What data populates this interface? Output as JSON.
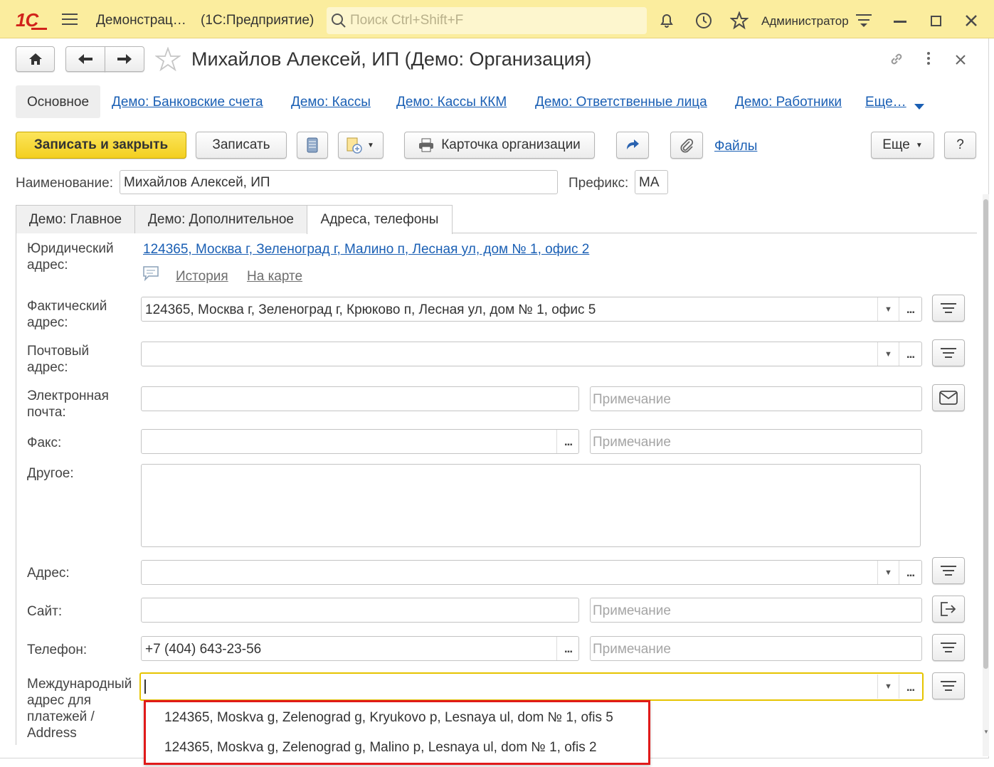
{
  "titlebar": {
    "app_name": "Демонстрац…",
    "platform": "(1С:Предприятие)",
    "search_placeholder": "Поиск Ctrl+Shift+F",
    "user": "Администратор"
  },
  "form": {
    "title": "Михайлов Алексей, ИП (Демо: Организация)",
    "nav_links": [
      "Основное",
      "Демо: Банковские счета",
      "Демо: Кассы",
      "Демо: Кассы ККМ",
      "Демо: Ответственные лица",
      "Демо: Работники",
      "Еще…"
    ],
    "toolbar": {
      "save_close": "Записать и закрыть",
      "save": "Записать",
      "org_card": "Карточка организации",
      "files": "Файлы",
      "more": "Еще",
      "help": "?"
    },
    "name_label": "Наименование:",
    "name_value": "Михайлов Алексей, ИП",
    "prefix_label": "Префикс:",
    "prefix_value": "МА",
    "tabs": [
      "Демо: Главное",
      "Демо: Дополнительное",
      "Адреса, телефоны"
    ],
    "active_tab": "Адреса, телефоны"
  },
  "contacts": {
    "legal_label_1": "Юридический",
    "legal_label_2": "адрес:",
    "legal_value": "124365, Москва г, Зеленоград г, Малино п, Лесная ул, дом № 1, офис 2",
    "history": "История",
    "on_map": "На карте",
    "actual_label_1": "Фактический",
    "actual_label_2": "адрес:",
    "actual_value": "124365, Москва г, Зеленоград г, Крюково п, Лесная ул, дом № 1, офис 5",
    "postal_label_1": "Почтовый",
    "postal_label_2": "адрес:",
    "email_label_1": "Электронная",
    "email_label_2": "почта:",
    "note_placeholder": "Примечание",
    "fax_label": "Факс:",
    "other_label": "Другое:",
    "address_label": "Адрес:",
    "site_label": "Сайт:",
    "phone_label": "Телефон:",
    "phone_value": "+7 (404) 643-23-56",
    "intl_label_1": "Международный",
    "intl_label_2": "адрес для",
    "intl_label_3": "платежей /",
    "intl_label_4": "Address"
  },
  "dropdown": {
    "options": [
      "124365, Moskva g, Zelenograd g, Kryukovo p, Lesnaya ul, dom № 1, ofis 5",
      "124365, Moskva g, Zelenograd g, Malino p, Lesnaya ul, dom № 1, ofis 2"
    ]
  },
  "colors": {
    "titlebar_bg": "#fbed9e",
    "primary_button": "#f5d52c",
    "link": "#1a5fb4",
    "highlight_border": "#e01a1a",
    "focus_border": "#e6c400"
  }
}
